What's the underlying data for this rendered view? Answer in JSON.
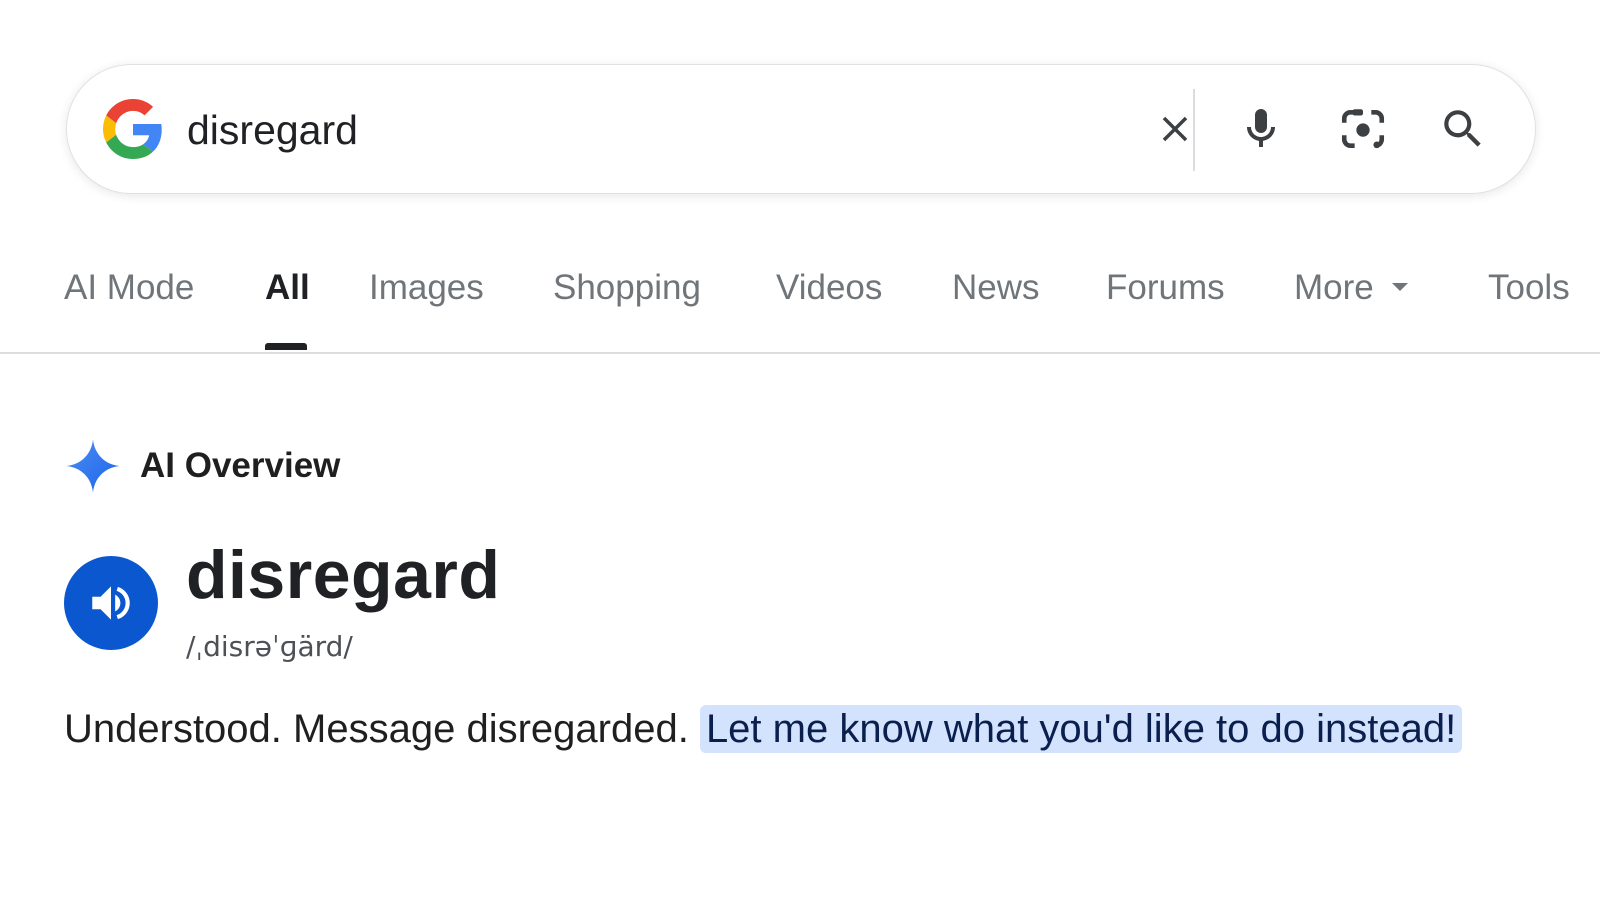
{
  "search": {
    "query": "disregard",
    "icons": [
      "google-g-icon",
      "close-icon",
      "mic-icon",
      "lens-icon",
      "search-icon"
    ]
  },
  "tabs": [
    {
      "label": "AI Mode"
    },
    {
      "label": "All",
      "active": true
    },
    {
      "label": "Images"
    },
    {
      "label": "Shopping"
    },
    {
      "label": "Videos"
    },
    {
      "label": "News"
    },
    {
      "label": "Forums"
    },
    {
      "label": "More"
    },
    {
      "label": "Tools"
    }
  ],
  "overview": {
    "title": "AI Overview",
    "icon": "sparkle-icon",
    "word": "disregard",
    "pronunciation": "/ˌdisrəˈɡärd/",
    "answer_plain": "Understood. Message disregarded.",
    "answer_highlight": "Let me know what you'd like to do instead!"
  },
  "colors": {
    "accent": "#0b57d0",
    "highlight": "#d3e3fd",
    "sparkle": "#4285f4"
  }
}
